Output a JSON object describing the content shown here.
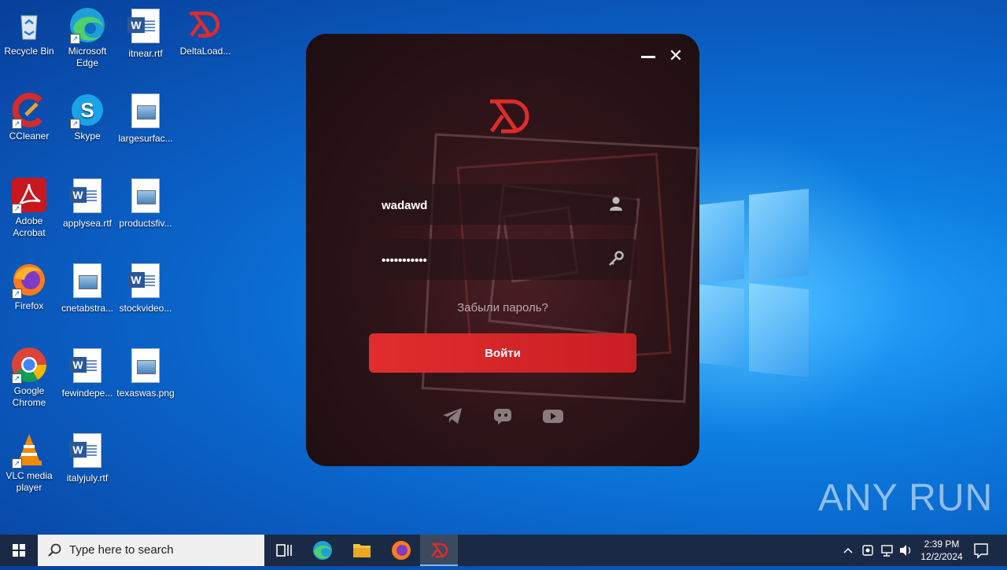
{
  "desktop": {
    "icons": [
      {
        "label": "Recycle Bin",
        "icon": "recycle-bin-icon"
      },
      {
        "label": "Microsoft Edge",
        "icon": "edge-icon"
      },
      {
        "label": "itnear.rtf",
        "icon": "word-doc-icon"
      },
      {
        "label": "DeltaLoad...",
        "icon": "deltaload-icon"
      },
      {
        "label": "CCleaner",
        "icon": "ccleaner-icon"
      },
      {
        "label": "Skype",
        "icon": "skype-icon"
      },
      {
        "label": "largesurfac...",
        "icon": "image-doc-icon"
      },
      {
        "label": "Adobe Acrobat",
        "icon": "acrobat-icon"
      },
      {
        "label": "applysea.rtf",
        "icon": "word-doc-icon"
      },
      {
        "label": "productsfiv...",
        "icon": "image-doc-icon"
      },
      {
        "label": "Firefox",
        "icon": "firefox-icon"
      },
      {
        "label": "cnetabstra...",
        "icon": "image-doc-icon"
      },
      {
        "label": "stockvideo...",
        "icon": "word-doc-icon"
      },
      {
        "label": "Google Chrome",
        "icon": "chrome-icon"
      },
      {
        "label": "fewindepe...",
        "icon": "word-doc-icon"
      },
      {
        "label": "texaswas.png",
        "icon": "image-doc-icon"
      },
      {
        "label": "VLC media player",
        "icon": "vlc-icon"
      },
      {
        "label": "italyjuly.rtf",
        "icon": "word-doc-icon"
      }
    ],
    "watermark": "ANY RUN"
  },
  "app": {
    "username_value": "wadawd",
    "password_value": "•••••••••••",
    "forgot_label": "Забыли пароль?",
    "login_label": "Войти",
    "accent": "#e02b2b"
  },
  "taskbar": {
    "search_placeholder": "Type here to search",
    "time": "2:39 PM",
    "date": "12/2/2024"
  }
}
